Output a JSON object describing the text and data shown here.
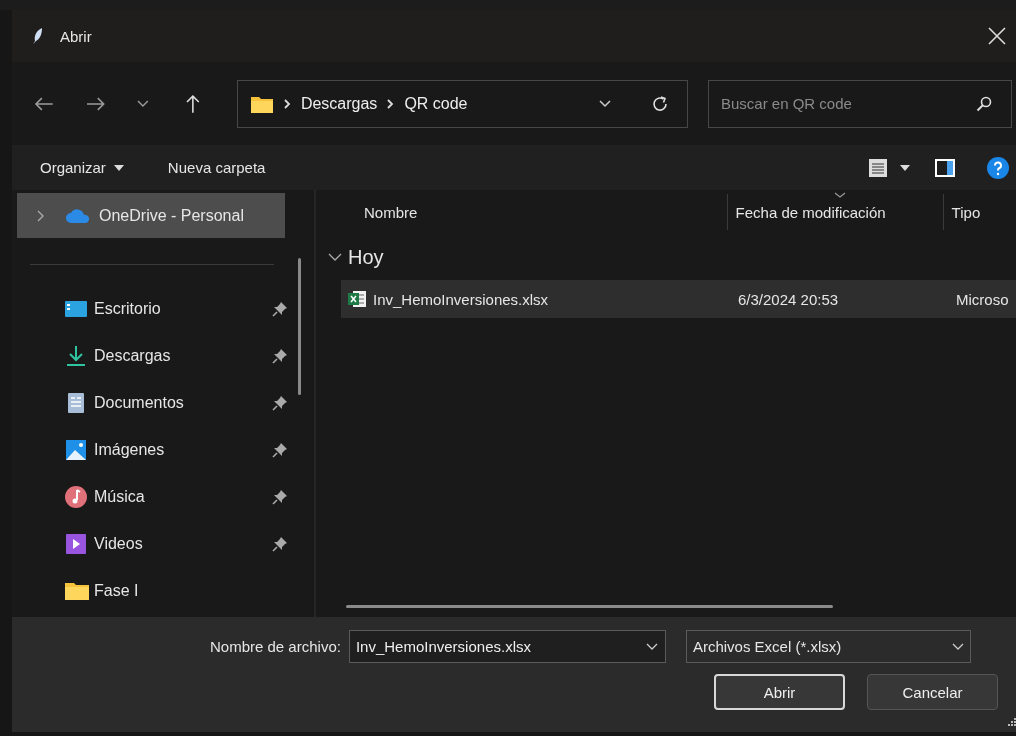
{
  "window": {
    "title": "Abrir"
  },
  "address": {
    "segments": [
      "Descargas",
      "QR code"
    ]
  },
  "search": {
    "placeholder": "Buscar en QR code"
  },
  "command_bar": {
    "organize": "Organizar",
    "new_folder": "Nueva carpeta"
  },
  "sidebar": {
    "top_item": {
      "label": "OneDrive - Personal",
      "selected": true,
      "expanded": false
    },
    "items": [
      {
        "label": "Escritorio",
        "kind": "desktop",
        "pinned": true
      },
      {
        "label": "Descargas",
        "kind": "downloads",
        "pinned": true
      },
      {
        "label": "Documentos",
        "kind": "documents",
        "pinned": true
      },
      {
        "label": "Imágenes",
        "kind": "pictures",
        "pinned": true
      },
      {
        "label": "Música",
        "kind": "music",
        "pinned": true
      },
      {
        "label": "Videos",
        "kind": "videos",
        "pinned": true
      },
      {
        "label": "Fase I",
        "kind": "folder",
        "pinned": false
      }
    ]
  },
  "file_list": {
    "columns": [
      "Nombre",
      "Fecha de modificación",
      "Tipo"
    ],
    "groups": [
      {
        "label": "Hoy",
        "expanded": true,
        "files": [
          {
            "name": "Inv_HemoInversiones.xlsx",
            "modified": "6/3/2024 20:53",
            "type": "Microso",
            "selected": true
          }
        ]
      }
    ]
  },
  "footer": {
    "filename_label": "Nombre de archivo:",
    "filename": "Inv_HemoInversiones.xlsx",
    "filter": "Archivos Excel (*.xlsx)",
    "buttons": [
      {
        "label": "Abrir",
        "kind": "primary"
      },
      {
        "label": "Cancelar",
        "kind": "secondary"
      }
    ]
  }
}
